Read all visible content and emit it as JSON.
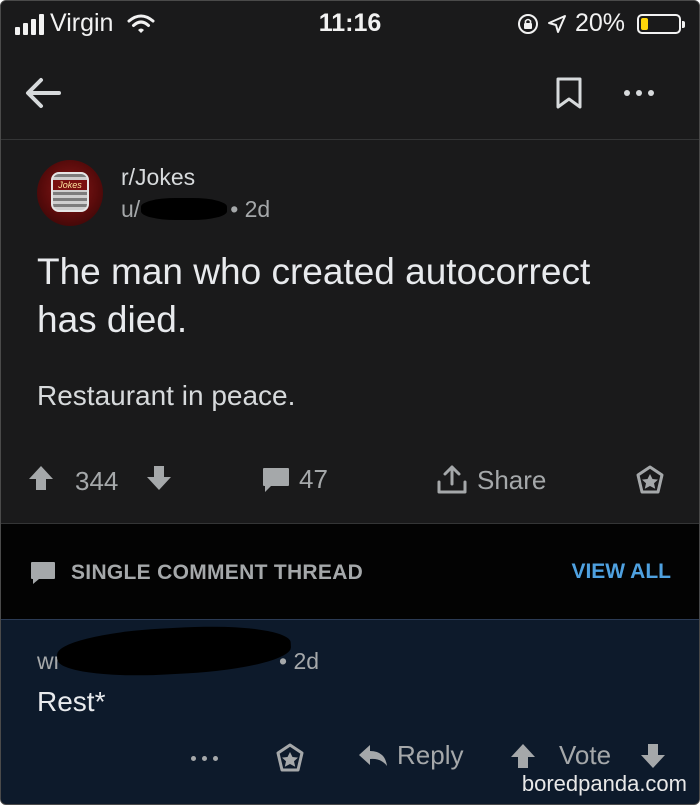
{
  "status_bar": {
    "carrier": "Virgin",
    "time": "11:16",
    "battery_percent": "20%",
    "battery_level": 0.2,
    "battery_color": "#ffd60a"
  },
  "header": {
    "back_icon": "arrow-left-icon",
    "bookmark_icon": "bookmark-icon",
    "more_icon": "ellipsis-icon"
  },
  "post": {
    "subreddit": "r/Jokes",
    "author": "u/",
    "age": "• 2d",
    "avatar_label": "Jokes",
    "title": "The man who created autocorrect has died.",
    "body": "Restaurant in peace.",
    "score": "344",
    "comment_count": "47",
    "share_label": "Share"
  },
  "thread": {
    "label": "SINGLE COMMENT THREAD",
    "view_all": "VIEW ALL"
  },
  "comment": {
    "author": "wr",
    "age": "• 2d",
    "text": "Rest*",
    "reply_label": "Reply",
    "vote_label": "Vote"
  },
  "watermark": "boredpanda.com",
  "colors": {
    "background": "#1a1a1b",
    "thread_bar": "#030303",
    "comment_highlight": "#0d1a2b",
    "link_blue": "#4fa1e0"
  }
}
